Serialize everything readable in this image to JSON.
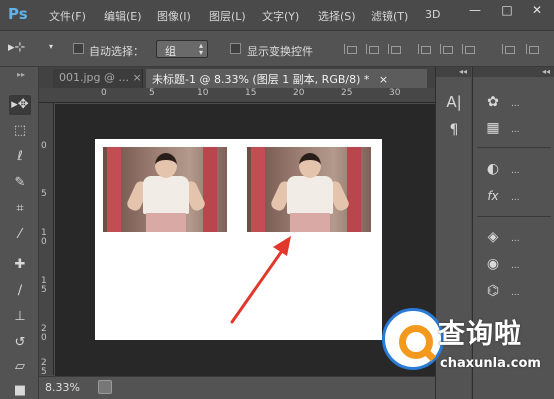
{
  "app": {
    "logo": "Ps"
  },
  "menubar": {
    "items": [
      "文件(F)",
      "编辑(E)",
      "图像(I)",
      "图层(L)",
      "文字(Y)",
      "选择(S)",
      "滤镜(T)",
      "3D"
    ],
    "window_controls": {
      "minimize": "—",
      "restore": "□",
      "close": "✕"
    }
  },
  "options": {
    "auto_select_label": "自动选择：",
    "group_value": "组",
    "show_transform_label": "显示变换控件"
  },
  "tabs": [
    {
      "label": "001.jpg @ ...",
      "close": "×",
      "active": false
    },
    {
      "label": "未标题-1 @ 8.33% (图层 1 副本, RGB/8) *",
      "close": "×",
      "active": true
    }
  ],
  "ruler_top": [
    "0",
    "5",
    "10",
    "15",
    "20",
    "25",
    "30"
  ],
  "ruler_left": [
    "0",
    "5",
    "1\n0",
    "1\n5",
    "2\n0",
    "2\n5"
  ],
  "status": {
    "zoom": "8.33%"
  },
  "panels": {
    "strip1_collapse": "◂◂",
    "strip2_collapse": "◂◂",
    "dots": "..."
  },
  "watermark": {
    "title": "查询啦",
    "subtitle": "chaxunla.com"
  },
  "colors": {
    "accent_blue": "#2a7bd5",
    "accent_orange": "#f39a1e",
    "arrow_red": "#e2372b"
  }
}
